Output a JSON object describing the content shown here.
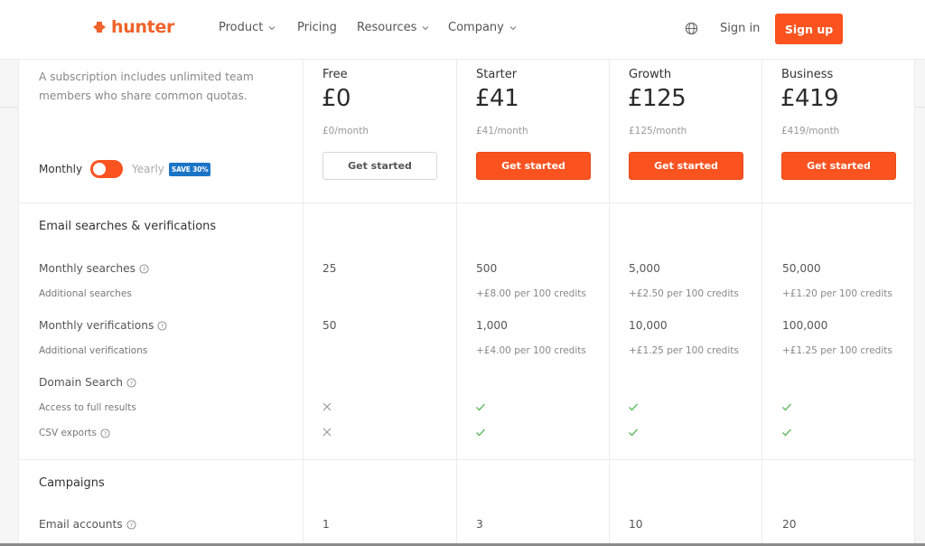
{
  "nav": {
    "brand": "hunter",
    "items": [
      {
        "label": "Product",
        "has_dropdown": true
      },
      {
        "label": "Pricing",
        "has_dropdown": false
      },
      {
        "label": "Resources",
        "has_dropdown": true
      },
      {
        "label": "Company",
        "has_dropdown": true
      }
    ],
    "language_icon": "globe-icon",
    "sign_in": "Sign in",
    "sign_up": "Sign up"
  },
  "colors": {
    "brand": "#fa5320",
    "badge": "#1a74c6",
    "check": "#5cb85c"
  },
  "intro": {
    "text": "A subscription includes unlimited team members who share common quotas.",
    "billing_toggle": {
      "left_label": "Monthly",
      "right_label": "Yearly",
      "selected": "Monthly",
      "badge": "SAVE 30%"
    }
  },
  "plans": [
    {
      "name": "Free",
      "price": "£0",
      "per_month": "£0/month",
      "cta": "Get started",
      "style": "secondary"
    },
    {
      "name": "Starter",
      "price": "£41",
      "per_month": "£41/month",
      "cta": "Get started",
      "style": "primary"
    },
    {
      "name": "Growth",
      "price": "£125",
      "per_month": "£125/month",
      "cta": "Get started",
      "style": "primary"
    },
    {
      "name": "Business",
      "price": "£419",
      "per_month": "£419/month",
      "cta": "Get started",
      "style": "primary"
    }
  ],
  "sections": [
    {
      "title": "Email searches & verifications",
      "rows": [
        {
          "label": "Monthly searches",
          "help": true,
          "values": [
            "25",
            "500",
            "5,000",
            "50,000"
          ]
        },
        {
          "label": "Additional searches",
          "sub": true,
          "values": [
            "",
            "+£8.00 per 100 credits",
            "+£2.50 per 100 credits",
            "+£1.20 per 100 credits"
          ]
        },
        {
          "label": "Monthly verifications",
          "help": true,
          "values": [
            "50",
            "1,000",
            "10,000",
            "100,000"
          ]
        },
        {
          "label": "Additional verifications",
          "sub": true,
          "values": [
            "",
            "+£4.00 per 100 credits",
            "+£1.25 per 100 credits",
            "+£1.25 per 100 credits"
          ]
        },
        {
          "label": "Domain Search",
          "help": true,
          "values": [
            "",
            "",
            "",
            ""
          ]
        },
        {
          "label": "Access to full results",
          "sub": true,
          "values": [
            "cross",
            "check",
            "check",
            "check"
          ]
        },
        {
          "label": "CSV exports",
          "sub": true,
          "help": true,
          "values": [
            "cross",
            "check",
            "check",
            "check"
          ]
        }
      ]
    },
    {
      "title": "Campaigns",
      "rows": [
        {
          "label": "Email accounts",
          "help": true,
          "values": [
            "1",
            "3",
            "10",
            "20"
          ]
        }
      ]
    }
  ]
}
